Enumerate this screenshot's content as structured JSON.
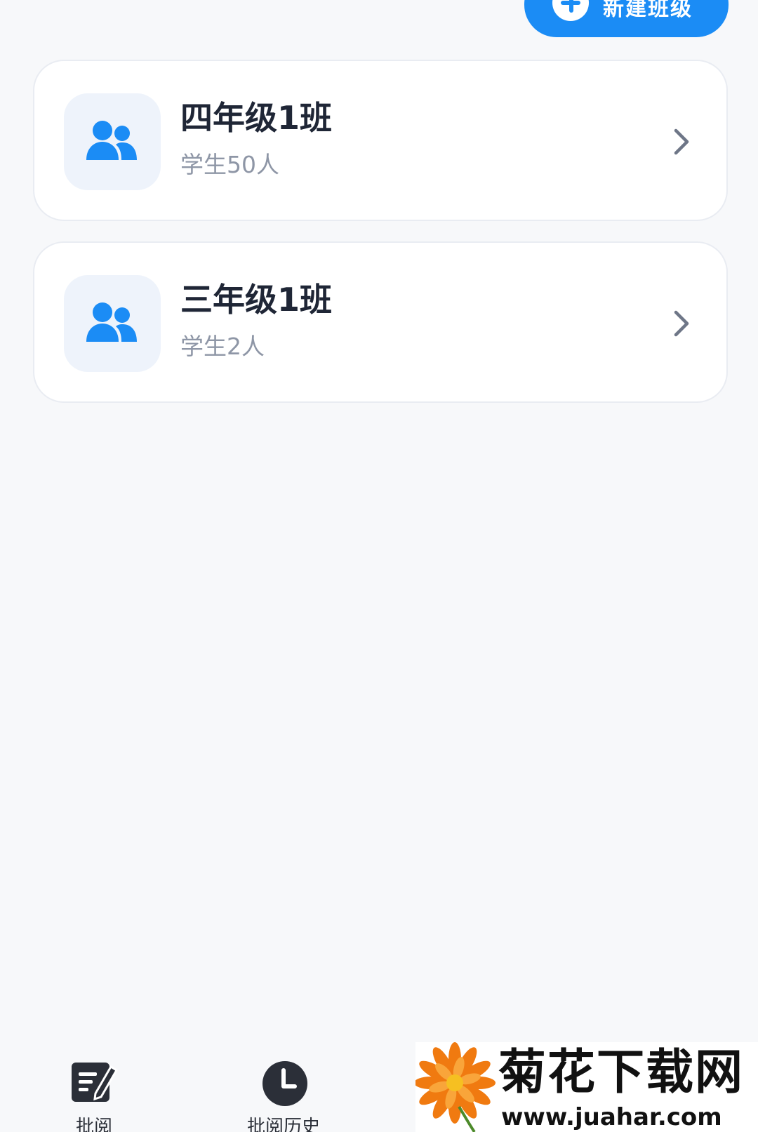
{
  "header": {
    "new_class_label": "新建班级"
  },
  "classes": [
    {
      "name": "四年级1班",
      "students": "学生50人"
    },
    {
      "name": "三年级1班",
      "students": "学生2人"
    }
  ],
  "tabbar": {
    "tabs": [
      {
        "label": "批阅",
        "icon": "edit-note-icon"
      },
      {
        "label": "批阅历史",
        "icon": "clock-icon"
      }
    ]
  },
  "watermark": {
    "name": "菊花下载网",
    "url": "www.juahar.com"
  },
  "colors": {
    "accent": "#1b8cf5",
    "background": "#f7f8fa",
    "card": "#ffffff",
    "title_text": "#1f2636",
    "sub_text": "#8e96a6"
  }
}
